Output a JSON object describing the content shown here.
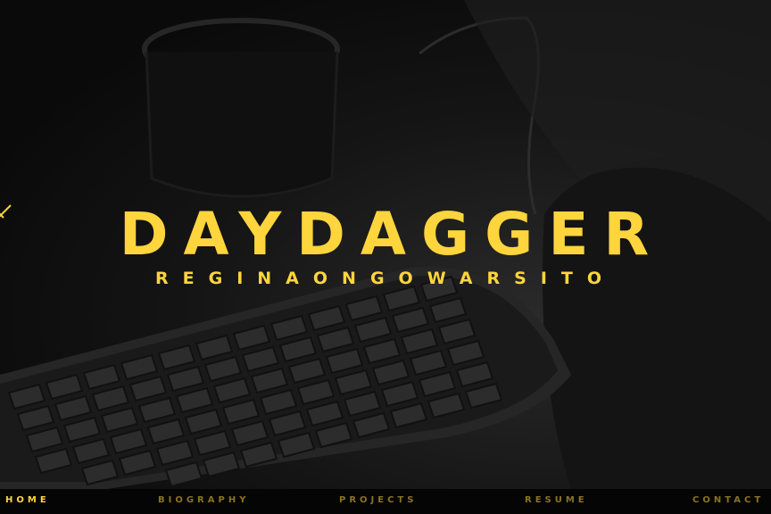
{
  "hero": {
    "title": "DAYDAGGER",
    "subtitle_first": "REGINA",
    "subtitle_last": "ONGOWARSITO",
    "accent_color": "#ffd53d",
    "divider_icon": "dagger-icon"
  },
  "nav": {
    "items": [
      {
        "label": "HOME",
        "active": true
      },
      {
        "label": "BIOGRAPHY"
      },
      {
        "label": "PROJECTS"
      },
      {
        "label": "RESUME"
      },
      {
        "label": "CONTACT"
      }
    ]
  }
}
